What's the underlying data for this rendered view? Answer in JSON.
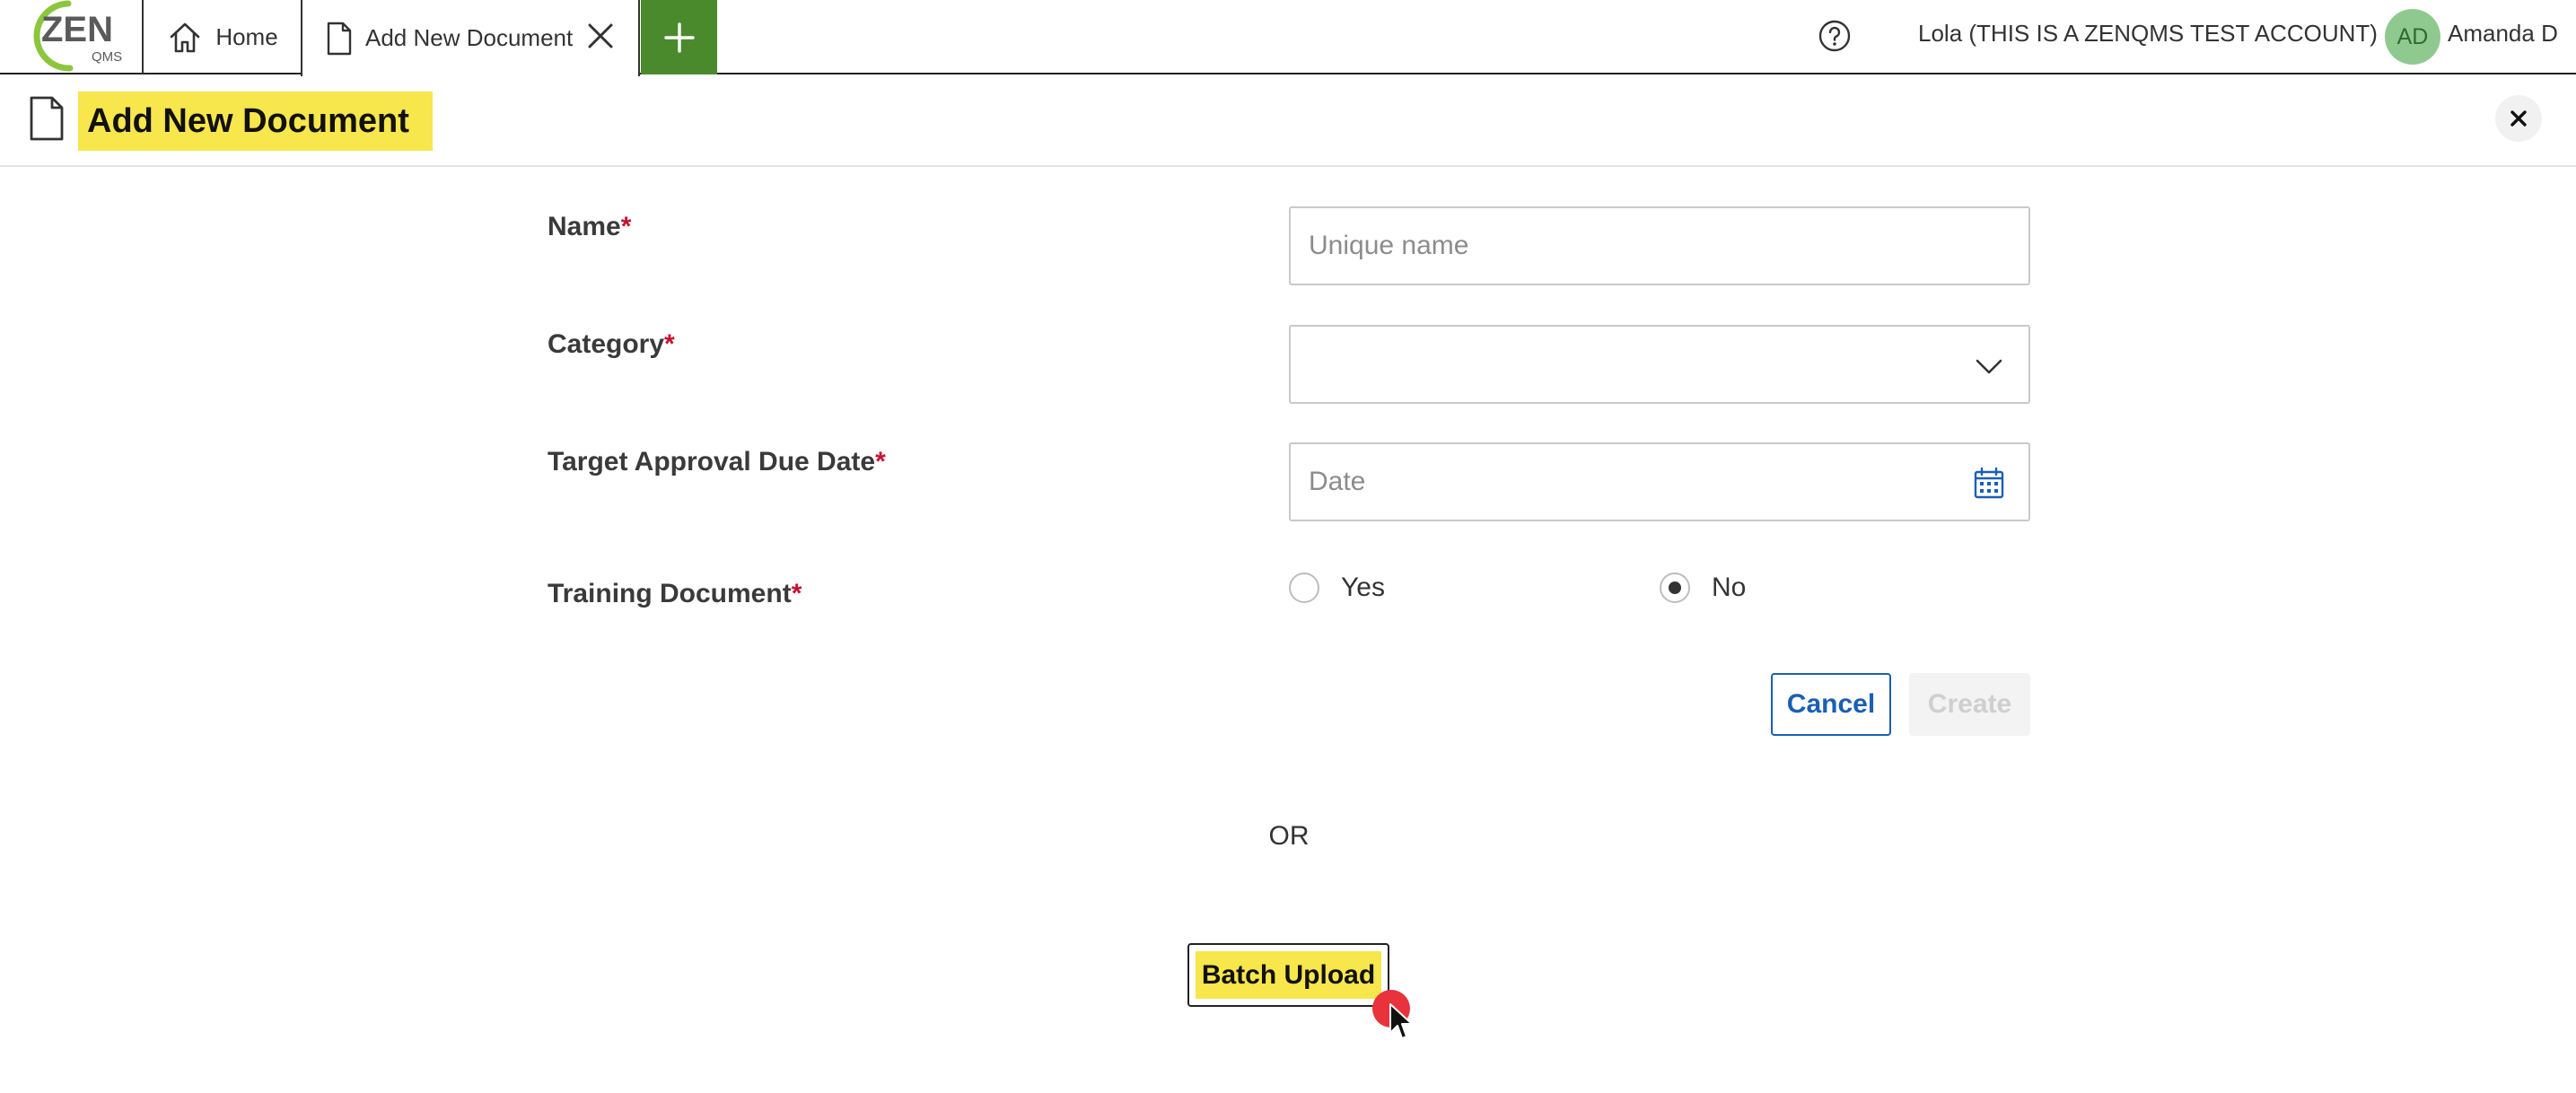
{
  "app": {
    "logo_text": "ZEN",
    "logo_subtext": "QMS"
  },
  "tabs": {
    "home_label": "Home",
    "active_label": "Add New Document"
  },
  "topbar": {
    "account_label": "Lola (THIS IS A ZENQMS TEST ACCOUNT)",
    "avatar_initials": "AD",
    "user_name": "Amanda D"
  },
  "page": {
    "title": "Add New Document"
  },
  "form": {
    "name_label": "Name",
    "name_placeholder": "Unique name",
    "category_label": "Category",
    "due_date_label": "Target Approval Due Date",
    "due_date_placeholder": "Date",
    "training_label": "Training Document",
    "required_marker": "*",
    "training_options": [
      {
        "label": "Yes",
        "selected": false
      },
      {
        "label": "No",
        "selected": true
      }
    ]
  },
  "actions": {
    "cancel_label": "Cancel",
    "create_label": "Create",
    "or_label": "OR",
    "batch_upload_label": "Batch Upload"
  },
  "colors": {
    "brand_green": "#4a8a2d",
    "highlight_yellow": "#f7e64c",
    "link_blue": "#1a5fb4",
    "required_red": "#c8102e",
    "click_marker": "#e8323c"
  }
}
